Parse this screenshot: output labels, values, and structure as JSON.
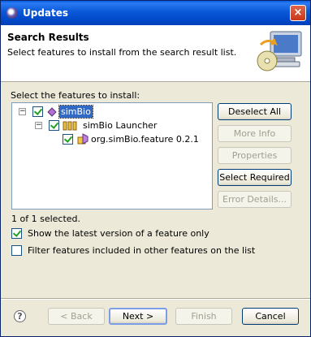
{
  "window": {
    "title": "Updates",
    "close_glyph": "×"
  },
  "header": {
    "title": "Search Results",
    "description": "Select features to install from the search result list.",
    "icon": "update-computer-icon"
  },
  "tree": {
    "label": "Select the features to install:",
    "nodes": [
      {
        "label": "simBio",
        "checked": true,
        "expanded": true,
        "selected": true,
        "icon": "category-icon"
      },
      {
        "label": "simBio Launcher",
        "checked": true,
        "expanded": true,
        "selected": false,
        "icon": "feature-group-icon"
      },
      {
        "label": "org.simBio.feature 0.2.1",
        "checked": true,
        "expanded": false,
        "selected": false,
        "icon": "feature-icon"
      }
    ]
  },
  "side_buttons": {
    "deselect_all": "Deselect All",
    "more_info": "More Info",
    "properties": "Properties",
    "select_required": "Select Required",
    "error_details": "Error Details..."
  },
  "status": "1 of 1 selected.",
  "options": {
    "latest_version": {
      "label": "Show the latest version of a feature only",
      "checked": true
    },
    "filter_features": {
      "label": "Filter features included in other features on the list",
      "checked": false
    }
  },
  "footer": {
    "back": "< Back",
    "next": "Next >",
    "finish": "Finish",
    "cancel": "Cancel",
    "help_glyph": "?"
  }
}
